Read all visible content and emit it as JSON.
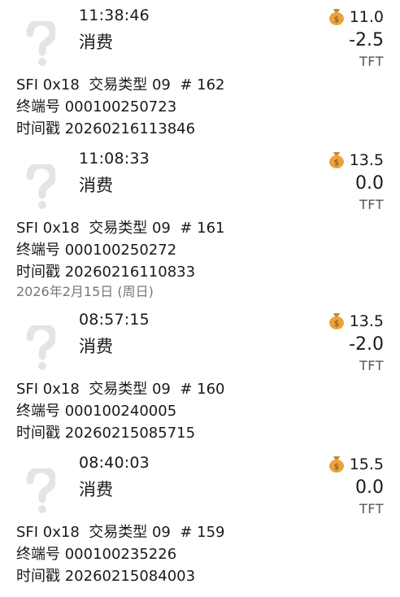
{
  "transactions_day1": [
    {
      "time": "11:38:46",
      "type": "消费",
      "balance": "11.0",
      "amount": "-2.5",
      "currency": "TFT",
      "sfi_line": "SFI 0x18  交易类型 09  # 162",
      "terminal_line": "终端号 000100250723",
      "timestamp_line": "时间戳 20260216113846"
    },
    {
      "time": "11:08:33",
      "type": "消费",
      "balance": "13.5",
      "amount": "0.0",
      "currency": "TFT",
      "sfi_line": "SFI 0x18  交易类型 09  # 161",
      "terminal_line": "终端号 000100250272",
      "timestamp_line": "时间戳 20260216110833"
    }
  ],
  "date_header": "2026年2月15日 (周日)",
  "transactions_day2": [
    {
      "time": "08:57:15",
      "type": "消费",
      "balance": "13.5",
      "amount": "-2.0",
      "currency": "TFT",
      "sfi_line": "SFI 0x18  交易类型 09  # 160",
      "terminal_line": "终端号 000100240005",
      "timestamp_line": "时间戳 20260215085715"
    },
    {
      "time": "08:40:03",
      "type": "消费",
      "balance": "15.5",
      "amount": "0.0",
      "currency": "TFT",
      "sfi_line": "SFI 0x18  交易类型 09  # 159",
      "terminal_line": "终端号 000100235226",
      "timestamp_line": "时间戳 20260215084003"
    }
  ],
  "icons": {
    "transaction_icon": "question-mark-icon",
    "balance_icon": "money-bag-icon"
  },
  "colors": {
    "text": "#1a1a1a",
    "muted": "#777777",
    "question_mark": "#e4e4e4",
    "money_bag": "#e8a33c"
  }
}
